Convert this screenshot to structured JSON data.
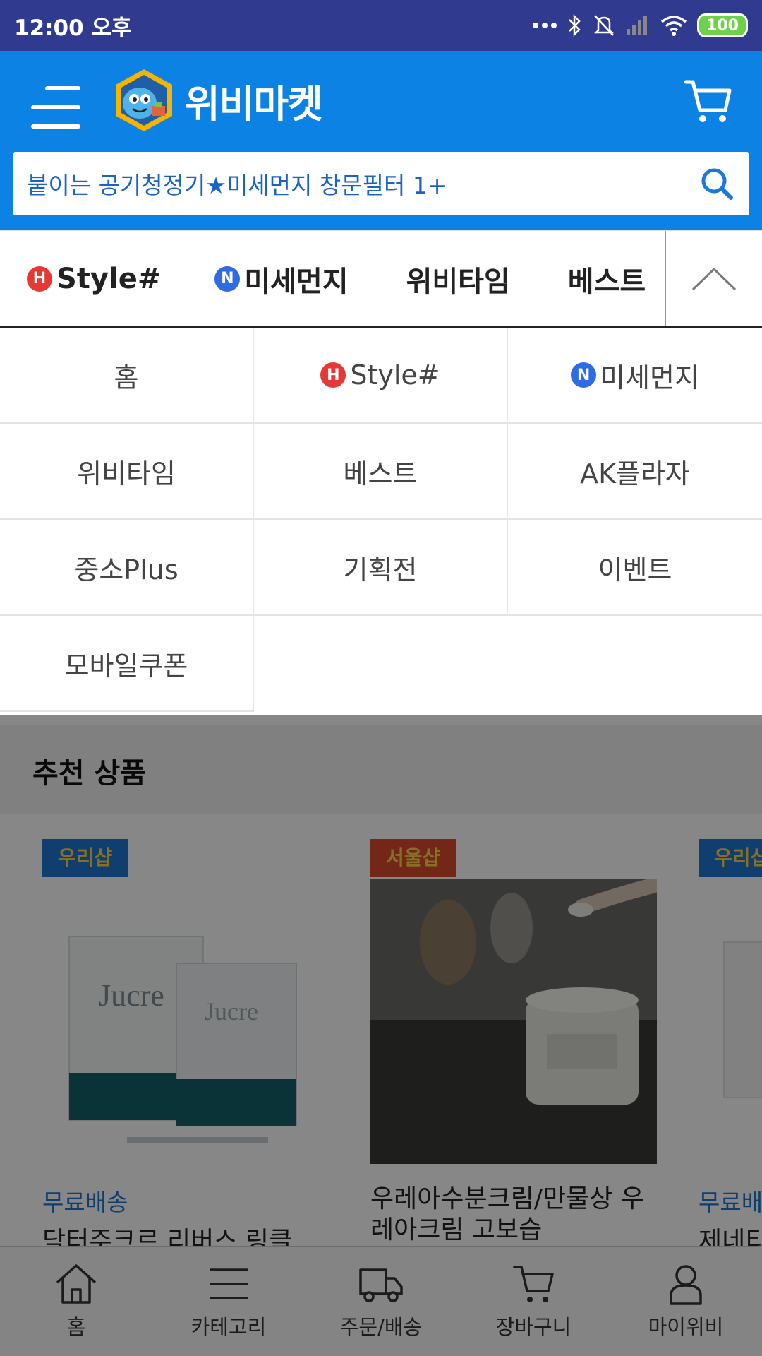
{
  "status_bar": {
    "time": "12:00 오후",
    "battery": "100"
  },
  "header": {
    "app_name": "위비마켓",
    "search_text": "붙이는 공기청정기★미세먼지 창문필터 1+"
  },
  "tabs": [
    {
      "label": "Style#",
      "badge": "H"
    },
    {
      "label": "미세먼지",
      "badge": "N"
    },
    {
      "label": "위비타임",
      "badge": ""
    },
    {
      "label": "베스트",
      "badge": ""
    }
  ],
  "dropdown": {
    "items": [
      {
        "label": "홈",
        "badge": ""
      },
      {
        "label": "Style#",
        "badge": "H"
      },
      {
        "label": "미세먼지",
        "badge": "N"
      },
      {
        "label": "위비타임",
        "badge": ""
      },
      {
        "label": "베스트",
        "badge": ""
      },
      {
        "label": "AK플라자",
        "badge": ""
      },
      {
        "label": "중소Plus",
        "badge": ""
      },
      {
        "label": "기획전",
        "badge": ""
      },
      {
        "label": "이벤트",
        "badge": ""
      },
      {
        "label": "모바일쿠폰",
        "badge": ""
      }
    ]
  },
  "recommended": {
    "title": "추천 상품",
    "products": [
      {
        "shop": "우리샵",
        "delivery": "무료배송",
        "name": "닥터주크르 리버스 링클"
      },
      {
        "shop": "서울샵",
        "delivery": "",
        "name": "우레아수분크림/만물상 우레아크림 고보습"
      },
      {
        "shop": "우리샵",
        "delivery": "무료배송",
        "name": "제네티"
      }
    ]
  },
  "bottom_nav": {
    "items": [
      {
        "label": "홈",
        "icon": "home-icon"
      },
      {
        "label": "카테고리",
        "icon": "menu-icon"
      },
      {
        "label": "주문/배송",
        "icon": "truck-icon"
      },
      {
        "label": "장바구니",
        "icon": "cart-icon"
      },
      {
        "label": "마이위비",
        "icon": "user-icon"
      }
    ]
  },
  "colors": {
    "header_bg": "#0b82e4",
    "status_bg": "#303a8e",
    "badge_h": "#e53935",
    "badge_n": "#2f6be3"
  }
}
